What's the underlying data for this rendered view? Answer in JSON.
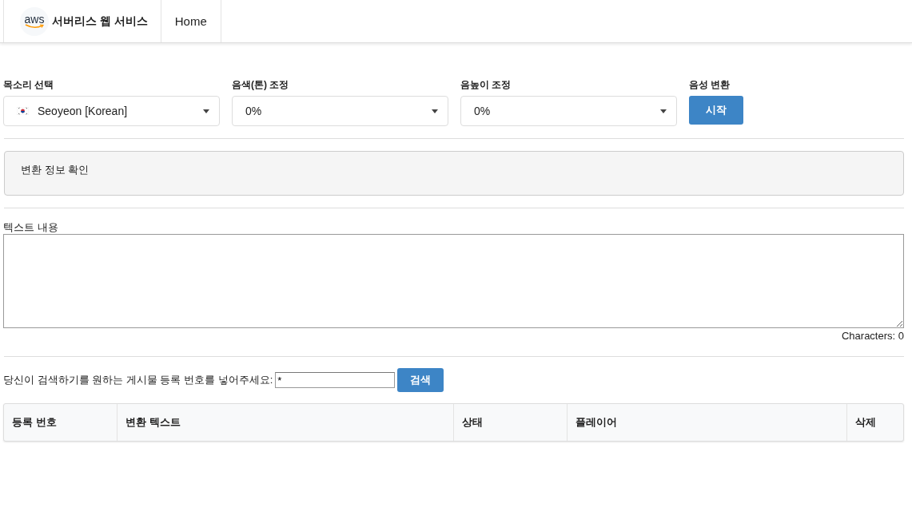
{
  "navbar": {
    "logo_text": "aws",
    "brand": "서버리스 웹 서비스",
    "items": [
      {
        "label": "Home",
        "selected": false
      }
    ]
  },
  "controls": [
    {
      "kind": "select",
      "label": "목소리 선택",
      "value": "Seoyeon [Korean]",
      "flag": true
    },
    {
      "kind": "select",
      "label": "음색(톤) 조정",
      "value": "0%"
    },
    {
      "kind": "select",
      "label": "음높이 조정",
      "value": "0%"
    },
    {
      "kind": "button",
      "label": "음성 변환",
      "value": "시작"
    }
  ],
  "info_panel": {
    "text": "변환 정보 확인"
  },
  "text_area": {
    "label": "텍스트 내용",
    "counter": "Characters: 0"
  },
  "search": {
    "label": "당신이 검색하기를 원하는 게시물 등록 번호를 넣어주세요:",
    "value": "*",
    "button": "검색"
  },
  "table": {
    "columns": [
      "등록 번호",
      "변환 텍스트",
      "상태",
      "플레이어",
      "삭제"
    ]
  }
}
